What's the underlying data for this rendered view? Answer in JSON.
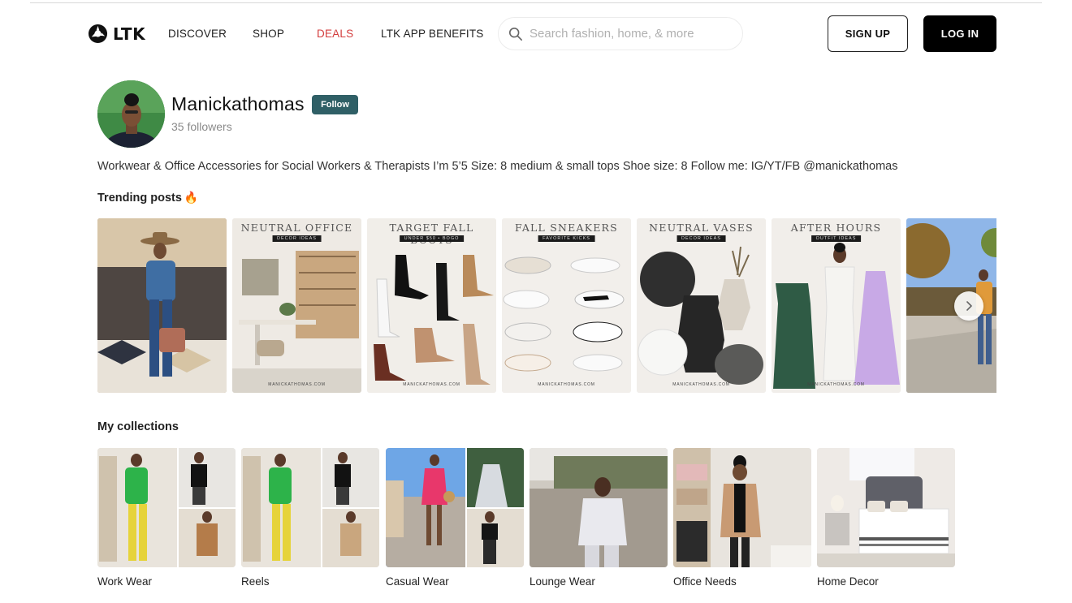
{
  "header": {
    "logo_text": "LTK",
    "nav": [
      {
        "label": "DISCOVER"
      },
      {
        "label": "SHOP"
      },
      {
        "label": "DEALS"
      },
      {
        "label": "LTK APP BENEFITS"
      }
    ],
    "search": {
      "placeholder": "Search fashion, home, & more",
      "value": ""
    },
    "signup_label": "SIGN UP",
    "login_label": "LOG IN",
    "deals_color": "#d33d3d"
  },
  "profile": {
    "username": "Manickathomas",
    "follow_label": "Follow",
    "followers": "35 followers",
    "bio": "Workwear & Office Accessories for Social Workers & Therapists I’m 5’5 Size: 8 medium & small tops Shoe size: 8 Follow me: IG/YT/FB @manickathomas",
    "follow_color": "#2f5f66"
  },
  "trending": {
    "title": "Trending posts",
    "emoji": "🔥",
    "posts": [
      {
        "caption": "",
        "sub": "",
        "foot": ""
      },
      {
        "caption": "NEUTRAL OFFICE",
        "sub": "DECOR IDEAS",
        "foot": "MANICKATHOMAS.COM"
      },
      {
        "caption": "TARGET FALL BOOTS",
        "sub": "UNDER $50 • BOGO",
        "foot": "MANICKATHOMAS.COM"
      },
      {
        "caption": "FALL SNEAKERS",
        "sub": "FAVORITE KICKS",
        "foot": "MANICKATHOMAS.COM"
      },
      {
        "caption": "NEUTRAL VASES",
        "sub": "DECOR IDEAS",
        "foot": "MANICKATHOMAS.COM"
      },
      {
        "caption": "AFTER HOURS",
        "sub": "OUTFIT IDEAS",
        "foot": "MANICKATHOMAS.COM"
      },
      {
        "caption": "",
        "sub": "",
        "foot": ""
      }
    ]
  },
  "collections": {
    "title": "My collections",
    "items": [
      {
        "label": "Work Wear"
      },
      {
        "label": "Reels"
      },
      {
        "label": "Casual Wear"
      },
      {
        "label": "Lounge Wear"
      },
      {
        "label": "Office Needs"
      },
      {
        "label": "Home Decor"
      }
    ]
  }
}
